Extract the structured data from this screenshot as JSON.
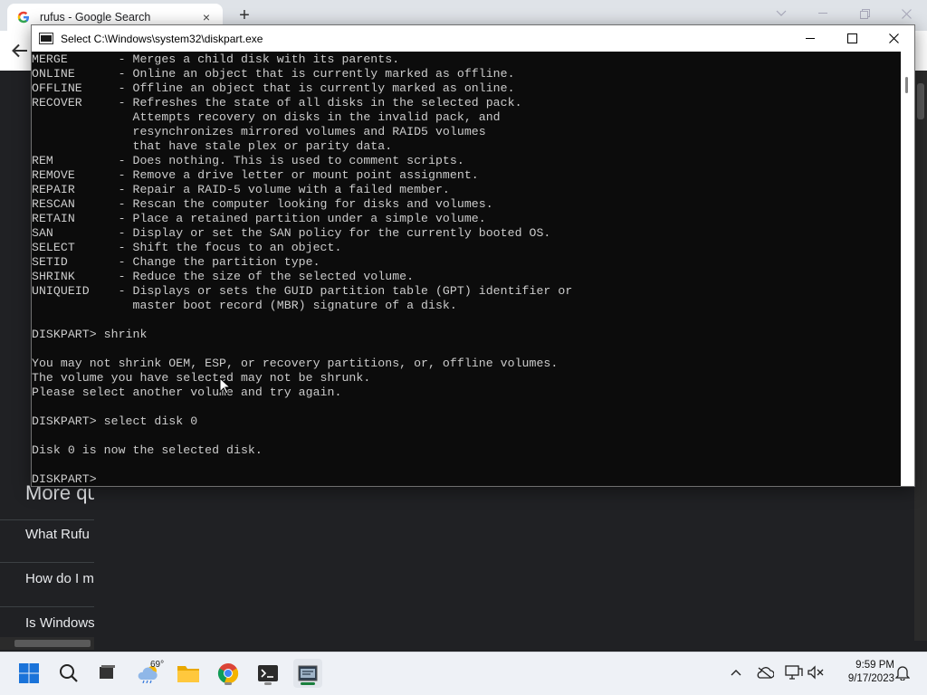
{
  "browser": {
    "tab_title": "rufus - Google Search",
    "tab_close": "×",
    "new_tab": "+",
    "faq_heading": "More qu",
    "faq_items": [
      "What Rufu",
      "How do I m",
      "Is Windows"
    ]
  },
  "console": {
    "title": "Select C:\\Windows\\system32\\diskpart.exe",
    "lines": [
      "MERGE       - Merges a child disk with its parents.",
      "ONLINE      - Online an object that is currently marked as offline.",
      "OFFLINE     - Offline an object that is currently marked as online.",
      "RECOVER     - Refreshes the state of all disks in the selected pack.",
      "              Attempts recovery on disks in the invalid pack, and",
      "              resynchronizes mirrored volumes and RAID5 volumes",
      "              that have stale plex or parity data.",
      "REM         - Does nothing. This is used to comment scripts.",
      "REMOVE      - Remove a drive letter or mount point assignment.",
      "REPAIR      - Repair a RAID-5 volume with a failed member.",
      "RESCAN      - Rescan the computer looking for disks and volumes.",
      "RETAIN      - Place a retained partition under a simple volume.",
      "SAN         - Display or set the SAN policy for the currently booted OS.",
      "SELECT      - Shift the focus to an object.",
      "SETID       - Change the partition type.",
      "SHRINK      - Reduce the size of the selected volume.",
      "UNIQUEID    - Displays or sets the GUID partition table (GPT) identifier or",
      "              master boot record (MBR) signature of a disk.",
      "",
      "DISKPART> shrink",
      "",
      "You may not shrink OEM, ESP, or recovery partitions, or, offline volumes.",
      "The volume you have selected may not be shrunk.",
      "Please select another volume and try again.",
      "",
      "DISKPART> select disk 0",
      "",
      "Disk 0 is now the selected disk.",
      "",
      "DISKPART> "
    ]
  },
  "taskbar": {
    "weather_temp": "69°",
    "clock_time": "9:59 PM",
    "clock_date": "9/17/2023"
  },
  "colors": {
    "console_bg": "#0c0c0c",
    "console_text": "#cccccc",
    "browser_bg": "#202124",
    "taskbar_bg": "#eef1f6",
    "active_indicator": "#1a7f3d"
  }
}
